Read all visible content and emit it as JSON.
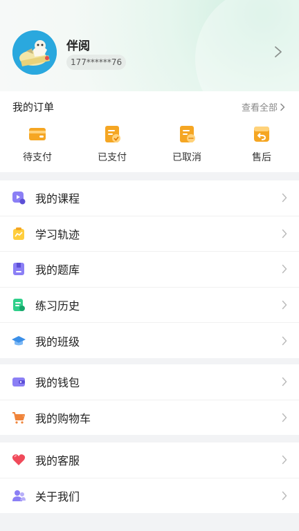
{
  "profile": {
    "name": "伴阅",
    "phone": "177******76"
  },
  "orders": {
    "title": "我的订单",
    "view_all": "查看全部",
    "items": [
      {
        "label": "待支付",
        "icon": "wallet-pending-icon"
      },
      {
        "label": "已支付",
        "icon": "paid-icon"
      },
      {
        "label": "已取消",
        "icon": "cancelled-icon"
      },
      {
        "label": "售后",
        "icon": "after-sale-icon"
      }
    ]
  },
  "menu_group1": [
    {
      "label": "我的课程",
      "icon": "course-icon"
    },
    {
      "label": "学习轨迹",
      "icon": "learning-track-icon"
    },
    {
      "label": "我的题库",
      "icon": "question-bank-icon"
    },
    {
      "label": "练习历史",
      "icon": "practice-history-icon"
    },
    {
      "label": "我的班级",
      "icon": "class-icon"
    }
  ],
  "menu_group2": [
    {
      "label": "我的钱包",
      "icon": "wallet-icon"
    },
    {
      "label": "我的购物车",
      "icon": "cart-icon"
    }
  ],
  "menu_group3": [
    {
      "label": "我的客服",
      "icon": "customer-service-icon"
    },
    {
      "label": "关于我们",
      "icon": "about-us-icon"
    }
  ],
  "colors": {
    "accent_orange": "#f5a623",
    "accent_purple": "#7b6ff0",
    "accent_green": "#2fcf8a",
    "accent_blue": "#3b8fe8",
    "accent_red": "#f04a5a"
  }
}
